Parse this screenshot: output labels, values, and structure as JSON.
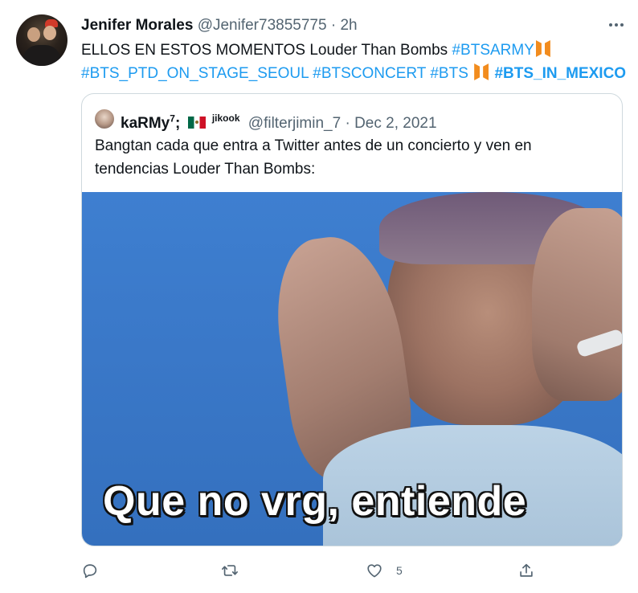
{
  "tweet": {
    "author_name": "Jenifer Morales",
    "author_handle": "@Jenifer73855775",
    "separator": "·",
    "time": "2h",
    "text_plain": "ELLOS EN ESTOS MOMENTOS Louder Than Bombs",
    "hashtags": [
      "#BTSARMY",
      "#BTS_PTD_ON_STAGE_SEOUL",
      "#BTSCONCERT",
      "#BTS",
      "#BTS_IN_MEXICO"
    ],
    "emoji_icon": "bts-logo-icon"
  },
  "quote": {
    "author_name": "kaRMy",
    "author_sup": "7",
    "author_suffix": ";",
    "flag_icon": "mexico-flag-icon",
    "jikook": "jikook",
    "author_handle": "@filterjimin_7",
    "separator": "·",
    "date": "Dec 2, 2021",
    "text": "Bangtan cada que entra a Twitter antes de un concierto y ven en tendencias Louder Than Bombs:",
    "media_caption": "Que no vrg, entiende"
  },
  "actions": {
    "reply_icon": "reply-icon",
    "retweet_icon": "retweet-icon",
    "like_icon": "heart-icon",
    "like_count": "5",
    "share_icon": "share-icon"
  },
  "colors": {
    "accent": "#1d9bf0",
    "muted": "#536471",
    "border": "#cfd9de",
    "bts_orange": "#f28c1e"
  }
}
